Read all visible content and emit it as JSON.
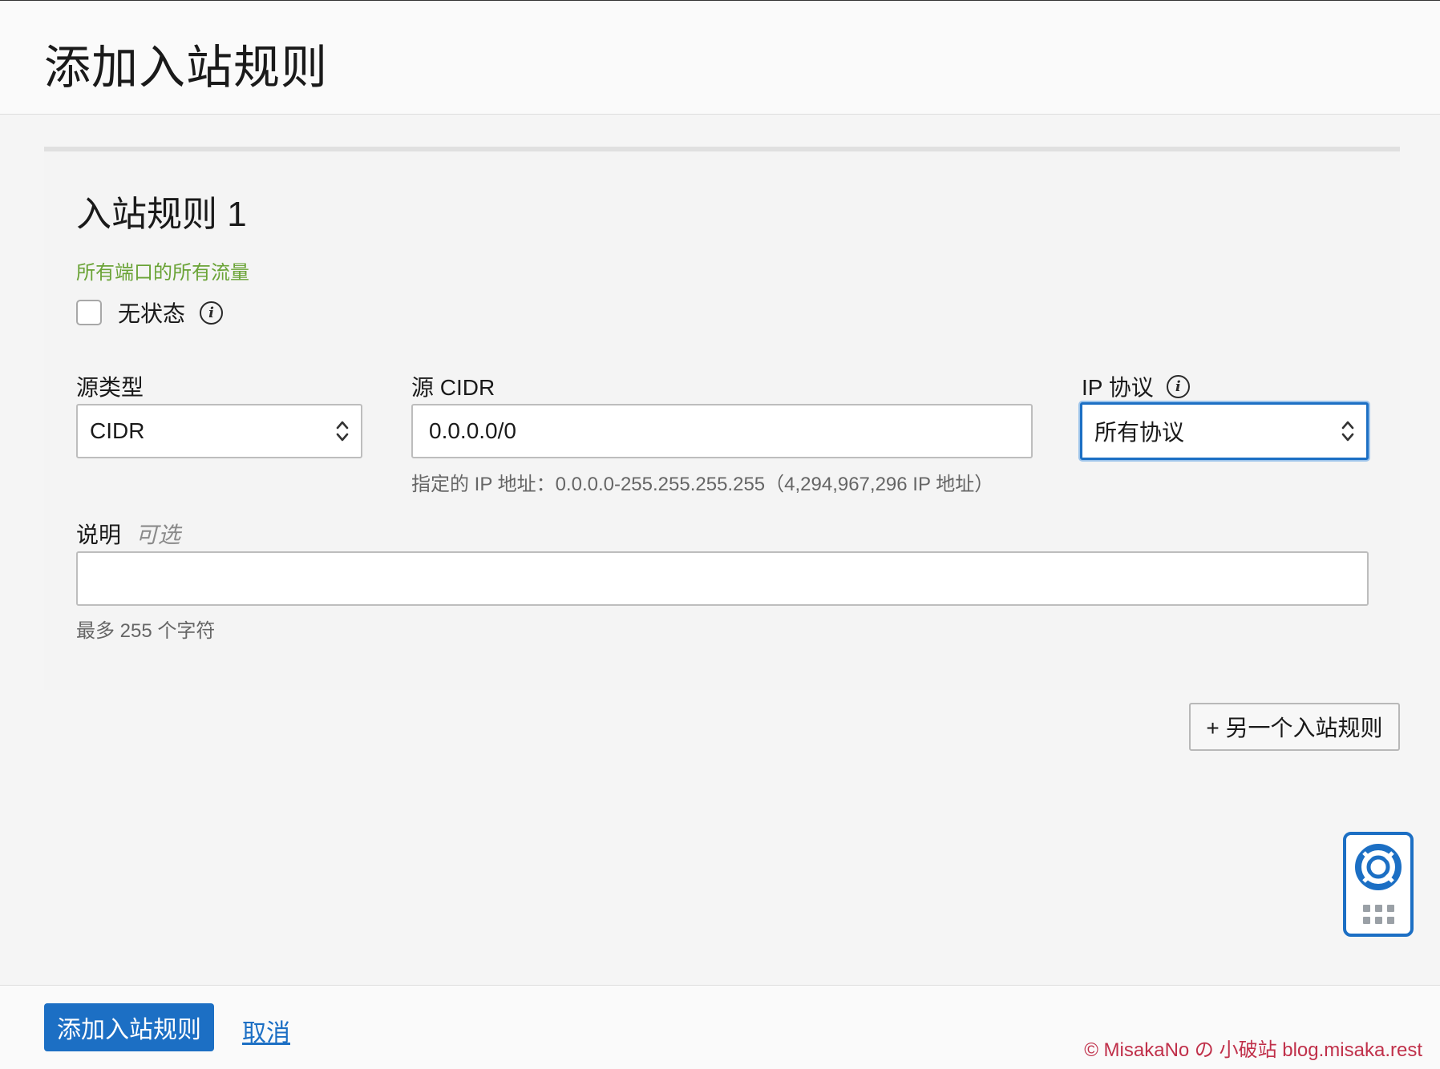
{
  "page": {
    "title": "添加入站规则"
  },
  "rule": {
    "title": "入站规则 1",
    "summary": "所有端口的所有流量",
    "stateless": {
      "label": "无状态",
      "checked": false,
      "info_icon": "info-icon"
    },
    "source_type": {
      "label": "源类型",
      "value": "CIDR"
    },
    "source_cidr": {
      "label": "源 CIDR",
      "value": "0.0.0.0/0",
      "hint": "指定的 IP 地址：0.0.0.0-255.255.255.255（4,294,967,296 IP 地址）"
    },
    "ip_protocol": {
      "label": "IP 协议",
      "value": "所有协议",
      "info_icon": "info-icon"
    },
    "description": {
      "label": "说明",
      "optional": "可选",
      "value": "",
      "hint": "最多 255 个字符"
    }
  },
  "actions": {
    "add_another": "+ 另一个入站规则",
    "submit": "添加入站规则",
    "cancel": "取消"
  },
  "help_widget": {
    "icon": "lifebuoy-icon"
  },
  "watermark": "© MisakaNo の 小破站 blog.misaka.rest",
  "colors": {
    "accent": "#1c6fc4",
    "summary_green": "#6aa336",
    "watermark": "#c0304a"
  }
}
